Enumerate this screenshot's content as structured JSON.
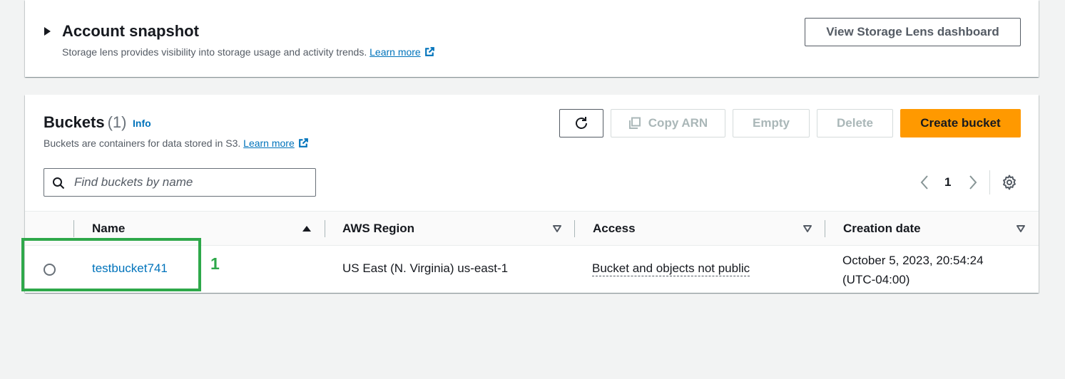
{
  "snapshot": {
    "title": "Account snapshot",
    "description": "Storage lens provides visibility into storage usage and activity trends.",
    "learn_more": "Learn more",
    "view_button": "View Storage Lens dashboard"
  },
  "buckets": {
    "title": "Buckets",
    "count": "(1)",
    "info": "Info",
    "description": "Buckets are containers for data stored in S3.",
    "learn_more": "Learn more",
    "actions": {
      "copy_arn": "Copy ARN",
      "empty": "Empty",
      "delete": "Delete",
      "create": "Create bucket"
    },
    "search": {
      "placeholder": "Find buckets by name",
      "value": ""
    },
    "pagination": {
      "current_page": "1"
    },
    "columns": [
      "Name",
      "AWS Region",
      "Access",
      "Creation date"
    ],
    "rows": [
      {
        "name": "testbucket741",
        "region": "US East (N. Virginia) us-east-1",
        "access": "Bucket and objects not public",
        "created_line1": "October 5, 2023, 20:54:24",
        "created_line2": "(UTC-04:00)"
      }
    ]
  },
  "annotation": {
    "label": "1",
    "color": "#2ea84a"
  },
  "colors": {
    "link": "#0073bb",
    "primary": "#ff9900",
    "background": "#f2f3f3"
  }
}
